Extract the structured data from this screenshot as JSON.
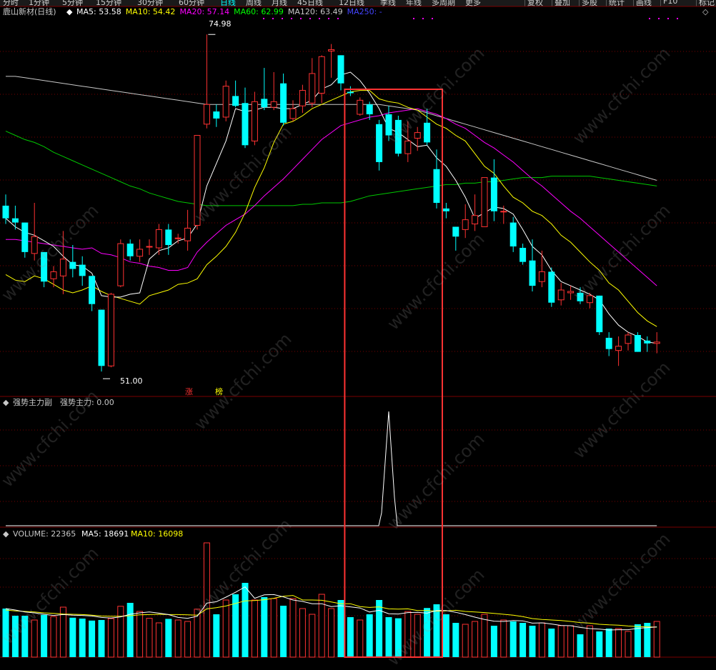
{
  "toolbar": {
    "periods": [
      "分时",
      "1分钟",
      "5分钟",
      "15分钟",
      "30分钟",
      "60分钟",
      "日线",
      "周线",
      "月线",
      "45日线",
      "12日线",
      "季线",
      "年线",
      "多周期",
      "更多"
    ],
    "active_period": "日线",
    "right_buttons": [
      "复权",
      "叠加",
      "多股",
      "统计",
      "画线",
      "F10",
      "标记"
    ]
  },
  "main_panel": {
    "title": "鹿山新材(日线)",
    "ma_labels": [
      {
        "name": "MA5",
        "value": "53.58",
        "color": "#ffffff"
      },
      {
        "name": "MA10",
        "value": "54.42",
        "color": "#ffff00"
      },
      {
        "name": "MA20",
        "value": "57.14",
        "color": "#ff00ff"
      },
      {
        "name": "MA60",
        "value": "62.99",
        "color": "#00ff00"
      },
      {
        "name": "MA120",
        "value": "63.49",
        "color": "#c8c8c8"
      },
      {
        "name": "MA250",
        "value": "-",
        "color": "#4444ff"
      }
    ],
    "high_label": "74.98",
    "low_label": "51.00",
    "tag_zhang": "涨",
    "tag_bang": "榜"
  },
  "indicator_panel": {
    "title": "强势主力副",
    "value_label": "强势主力: 0.00"
  },
  "volume_panel": {
    "title": "VOLUME: 22365",
    "ma5": "MA5: 18691",
    "ma10": "MA10: 16098"
  },
  "watermark": "www.cfchi.com",
  "colors": {
    "up": "#ff3232",
    "down": "#00ffff",
    "highlight_box": "#ff3232",
    "grid": "#7a0000"
  },
  "chart_data": {
    "type": "candlestick",
    "price_range": [
      51.0,
      74.98
    ],
    "candles": [
      {
        "o": 62.8,
        "c": 61.9,
        "h": 63.6,
        "l": 61.5
      },
      {
        "o": 61.9,
        "c": 61.6,
        "h": 62.8,
        "l": 61.1
      },
      {
        "o": 61.6,
        "c": 59.5,
        "h": 61.6,
        "l": 59.1
      },
      {
        "o": 59.4,
        "c": 60.6,
        "h": 63.0,
        "l": 58.9
      },
      {
        "o": 59.5,
        "c": 57.4,
        "h": 59.5,
        "l": 57.0
      },
      {
        "o": 57.6,
        "c": 58.1,
        "h": 58.5,
        "l": 57.0
      },
      {
        "o": 57.8,
        "c": 59.0,
        "h": 61.0,
        "l": 56.5
      },
      {
        "o": 58.8,
        "c": 58.3,
        "h": 60.0,
        "l": 57.7
      },
      {
        "o": 58.6,
        "c": 57.8,
        "h": 59.2,
        "l": 57.1
      },
      {
        "o": 57.8,
        "c": 55.8,
        "h": 57.8,
        "l": 55.3
      },
      {
        "o": 55.4,
        "c": 51.4,
        "h": 55.4,
        "l": 51.0
      },
      {
        "o": 51.4,
        "c": 56.5,
        "h": 56.6,
        "l": 51.3
      },
      {
        "o": 57.1,
        "c": 60.1,
        "h": 60.4,
        "l": 57.0
      },
      {
        "o": 60.1,
        "c": 59.2,
        "h": 60.4,
        "l": 58.9
      },
      {
        "o": 59.2,
        "c": 59.7,
        "h": 60.4,
        "l": 58.8
      },
      {
        "o": 59.9,
        "c": 59.9,
        "h": 60.4,
        "l": 59.3
      },
      {
        "o": 59.8,
        "c": 61.1,
        "h": 61.5,
        "l": 59.3
      },
      {
        "o": 61.1,
        "c": 60.0,
        "h": 61.5,
        "l": 59.3
      },
      {
        "o": 60.5,
        "c": 60.5,
        "h": 60.8,
        "l": 60.1
      },
      {
        "o": 60.3,
        "c": 61.2,
        "h": 62.5,
        "l": 59.6
      },
      {
        "o": 61.4,
        "c": 67.8,
        "h": 67.8,
        "l": 61.1
      },
      {
        "o": 68.6,
        "c": 70.0,
        "h": 74.98,
        "l": 68.3
      },
      {
        "o": 69.5,
        "c": 69.0,
        "h": 70.0,
        "l": 68.4
      },
      {
        "o": 69.1,
        "c": 71.3,
        "h": 71.7,
        "l": 68.8
      },
      {
        "o": 70.6,
        "c": 69.9,
        "h": 71.7,
        "l": 69.8
      },
      {
        "o": 70.1,
        "c": 67.1,
        "h": 71.2,
        "l": 66.9
      },
      {
        "o": 67.4,
        "c": 70.2,
        "h": 70.9,
        "l": 67.1
      },
      {
        "o": 70.4,
        "c": 69.8,
        "h": 72.6,
        "l": 69.6
      },
      {
        "o": 69.8,
        "c": 70.2,
        "h": 72.3,
        "l": 69.6
      },
      {
        "o": 71.5,
        "c": 68.7,
        "h": 72.2,
        "l": 68.5
      },
      {
        "o": 69.0,
        "c": 69.7,
        "h": 70.3,
        "l": 68.8
      },
      {
        "o": 69.9,
        "c": 71.0,
        "h": 71.4,
        "l": 69.4
      },
      {
        "o": 70.1,
        "c": 72.2,
        "h": 73.3,
        "l": 69.8
      },
      {
        "o": 70.8,
        "c": 73.4,
        "h": 73.5,
        "l": 70.1
      },
      {
        "o": 73.8,
        "c": 73.9,
        "h": 74.3,
        "l": 71.9
      },
      {
        "o": 73.5,
        "c": 71.5,
        "h": 73.5,
        "l": 71.0
      },
      {
        "o": 70.9,
        "c": 70.8,
        "h": 71.3,
        "l": 70.6
      },
      {
        "o": 69.3,
        "c": 70.3,
        "h": 70.5,
        "l": 69.2
      },
      {
        "o": 70.0,
        "c": 69.3,
        "h": 70.2,
        "l": 68.9
      },
      {
        "o": 68.6,
        "c": 65.9,
        "h": 68.9,
        "l": 65.3
      },
      {
        "o": 69.3,
        "c": 67.8,
        "h": 69.9,
        "l": 67.4
      },
      {
        "o": 68.9,
        "c": 66.5,
        "h": 69.2,
        "l": 66.3
      },
      {
        "o": 66.5,
        "c": 67.4,
        "h": 68.8,
        "l": 65.9
      },
      {
        "o": 67.6,
        "c": 68.0,
        "h": 68.4,
        "l": 66.7
      },
      {
        "o": 68.7,
        "c": 67.3,
        "h": 69.7,
        "l": 67.1
      },
      {
        "o": 65.4,
        "c": 63.0,
        "h": 66.8,
        "l": 62.6
      },
      {
        "o": 62.6,
        "c": 62.4,
        "h": 63.0,
        "l": 61.9
      },
      {
        "o": 61.3,
        "c": 60.6,
        "h": 61.3,
        "l": 59.6
      },
      {
        "o": 61.1,
        "c": 61.8,
        "h": 62.9,
        "l": 60.5
      },
      {
        "o": 61.5,
        "c": 62.1,
        "h": 63.6,
        "l": 61.0
      },
      {
        "o": 61.3,
        "c": 64.8,
        "h": 64.8,
        "l": 61.3
      },
      {
        "o": 64.8,
        "c": 62.4,
        "h": 66.1,
        "l": 61.7
      },
      {
        "o": 62.4,
        "c": 62.4,
        "h": 62.8,
        "l": 61.5
      },
      {
        "o": 61.6,
        "c": 59.9,
        "h": 62.0,
        "l": 59.5
      },
      {
        "o": 59.8,
        "c": 58.8,
        "h": 60.1,
        "l": 58.6
      },
      {
        "o": 58.9,
        "c": 57.1,
        "h": 60.4,
        "l": 56.7
      },
      {
        "o": 57.4,
        "c": 58.1,
        "h": 59.6,
        "l": 57.0
      },
      {
        "o": 58.1,
        "c": 55.9,
        "h": 58.4,
        "l": 55.6
      },
      {
        "o": 56.1,
        "c": 56.8,
        "h": 57.3,
        "l": 55.7
      },
      {
        "o": 56.6,
        "c": 56.7,
        "h": 57.1,
        "l": 56.1
      },
      {
        "o": 56.6,
        "c": 56.0,
        "h": 57.0,
        "l": 55.8
      },
      {
        "o": 55.9,
        "c": 56.4,
        "h": 56.6,
        "l": 55.5
      },
      {
        "o": 56.4,
        "c": 53.8,
        "h": 56.4,
        "l": 53.6
      },
      {
        "o": 53.4,
        "c": 52.6,
        "h": 53.8,
        "l": 52.1
      },
      {
        "o": 52.5,
        "c": 52.8,
        "h": 53.5,
        "l": 51.4
      },
      {
        "o": 53.0,
        "c": 53.6,
        "h": 53.8,
        "l": 52.5
      },
      {
        "o": 53.6,
        "c": 52.4,
        "h": 53.8,
        "l": 52.4
      },
      {
        "o": 53.2,
        "c": 53.0,
        "h": 53.5,
        "l": 52.4
      },
      {
        "o": 53.0,
        "c": 53.1,
        "h": 53.8,
        "l": 52.3
      }
    ],
    "ma5": [
      61.9,
      61.3,
      60.9,
      60.7,
      60.3,
      59.9,
      59.2,
      58.6,
      58.5,
      58.0,
      56.4,
      56.3,
      56.3,
      56.5,
      56.6,
      59.0,
      59.6,
      59.8,
      60.3,
      60.5,
      61.5,
      64.2,
      65.8,
      67.4,
      69.7,
      69.5,
      69.6,
      69.8,
      69.8,
      69.7,
      69.7,
      70.0,
      70.3,
      71.1,
      71.4,
      72.1,
      72.3,
      71.7,
      70.8,
      69.7,
      68.3,
      68.0,
      67.5,
      67.0,
      67.1,
      66.2,
      65.6,
      64.6,
      63.4,
      61.9,
      62.3,
      62.7,
      62.6,
      62.2,
      61.1,
      59.9,
      59.3,
      58.2,
      57.4,
      57.1,
      56.8,
      56.5,
      56.1,
      55.1,
      54.3,
      53.8,
      53.5,
      53.1,
      53.0
    ],
    "ma10": [
      57.9,
      57.5,
      57.4,
      57.8,
      57.6,
      57.2,
      56.8,
      56.6,
      56.8,
      57.1,
      56.7,
      56.4,
      56.2,
      56.0,
      55.8,
      56.4,
      56.6,
      56.8,
      57.2,
      57.3,
      57.6,
      58.6,
      59.2,
      59.9,
      60.9,
      62.3,
      64.1,
      65.5,
      67.3,
      68.6,
      68.8,
      69.2,
      69.7,
      70.0,
      70.3,
      70.6,
      70.9,
      71.0,
      71.0,
      70.4,
      70.2,
      70.1,
      69.8,
      69.6,
      69.1,
      68.6,
      68.3,
      67.8,
      67.4,
      66.5,
      65.6,
      65.1,
      64.2,
      63.4,
      63.0,
      62.4,
      62.1,
      61.5,
      60.7,
      60.2,
      59.5,
      58.8,
      58.2,
      57.3,
      56.8,
      56.0,
      55.2,
      54.6,
      54.2
    ],
    "ma20": [
      60.4,
      60.4,
      60.3,
      60.2,
      60.1,
      60.0,
      59.9,
      59.8,
      59.7,
      59.8,
      59.4,
      59.3,
      59.1,
      58.8,
      58.7,
      58.5,
      58.4,
      58.2,
      58.2,
      58.4,
      59.5,
      60.2,
      60.8,
      61.4,
      61.8,
      62.2,
      62.8,
      63.5,
      64.1,
      64.7,
      65.4,
      66.1,
      66.8,
      67.5,
      68.0,
      68.5,
      68.7,
      68.9,
      69.1,
      69.2,
      69.4,
      69.5,
      69.6,
      69.7,
      69.5,
      69.3,
      69.0,
      68.6,
      68.3,
      67.8,
      67.3,
      66.9,
      66.4,
      65.9,
      65.3,
      64.7,
      64.2,
      63.6,
      63.0,
      62.4,
      61.9,
      61.3,
      60.7,
      60.1,
      59.5,
      58.9,
      58.3,
      57.7,
      57.1
    ],
    "ma60": [
      68.1,
      67.8,
      67.5,
      67.3,
      67.0,
      66.6,
      66.3,
      66.0,
      65.7,
      65.4,
      65.1,
      64.8,
      64.5,
      64.2,
      64.0,
      63.7,
      63.5,
      63.3,
      63.1,
      63.0,
      62.9,
      62.8,
      62.8,
      62.8,
      62.8,
      62.8,
      62.8,
      62.8,
      62.8,
      62.8,
      62.8,
      62.9,
      62.9,
      63.0,
      63.0,
      63.0,
      63.1,
      63.3,
      63.5,
      63.6,
      63.7,
      63.8,
      63.9,
      64.0,
      64.1,
      64.2,
      64.3,
      64.3,
      64.4,
      64.4,
      64.5,
      64.5,
      64.6,
      64.7,
      64.8,
      64.8,
      64.8,
      64.9,
      64.9,
      64.9,
      64.9,
      64.9,
      64.8,
      64.7,
      64.6,
      64.5,
      64.4,
      64.3,
      64.2
    ],
    "ma120": [
      72.0,
      72.0,
      71.9,
      71.8,
      71.7,
      71.6,
      71.5,
      71.4,
      71.3,
      71.2,
      71.1,
      71.0,
      70.9,
      70.8,
      70.7,
      70.6,
      70.5,
      70.4,
      70.3,
      70.2,
      70.1,
      70.0,
      70.0,
      70.0,
      70.0,
      70.0,
      70.0,
      70.0,
      70.0,
      70.0,
      70.0,
      70.0,
      70.0,
      70.0,
      70.0,
      70.0,
      70.0,
      70.0,
      70.0,
      70.0,
      69.9,
      69.8,
      69.7,
      69.6,
      69.4,
      69.2,
      69.0,
      68.8,
      68.6,
      68.4,
      68.2,
      68.0,
      67.8,
      67.6,
      67.4,
      67.2,
      67.0,
      66.8,
      66.6,
      66.4,
      66.2,
      66.0,
      65.8,
      65.6,
      65.4,
      65.2,
      65.0,
      64.8,
      64.6
    ],
    "indicator": {
      "spike_index": 40,
      "spike_value": 1.0,
      "baseline": 0.0
    },
    "volume": [
      17000,
      14500,
      14500,
      13000,
      14800,
      14200,
      17500,
      13800,
      13500,
      12800,
      13000,
      13500,
      17800,
      19000,
      16000,
      13600,
      12000,
      13400,
      13000,
      12500,
      16800,
      40000,
      15000,
      20000,
      22000,
      26000,
      20000,
      21000,
      20500,
      18000,
      20500,
      17000,
      15000,
      22000,
      17000,
      20000,
      14000,
      13000,
      15000,
      20000,
      14000,
      13600,
      16000,
      15000,
      17200,
      18500,
      15000,
      12000,
      11500,
      12500,
      15000,
      11000,
      13000,
      12500,
      12000,
      11000,
      12000,
      10000,
      11000,
      11000,
      8000,
      11000,
      9000,
      10000,
      10000,
      9000,
      11500,
      12000,
      12500
    ],
    "vol_ma5": [
      17000,
      16500,
      15800,
      15500,
      15000,
      14600,
      14900,
      14700,
      14600,
      14400,
      13900,
      13700,
      14100,
      15000,
      15500,
      15800,
      15400,
      14900,
      13900,
      13600,
      14300,
      18900,
      19400,
      21000,
      22700,
      24600,
      20600,
      21800,
      21900,
      21100,
      20000,
      19500,
      18700,
      18700,
      17700,
      18000,
      17600,
      17200,
      15800,
      16400,
      15200,
      15100,
      15600,
      15700,
      15400,
      16300,
      16300,
      15700,
      14900,
      14000,
      13200,
      12600,
      12500,
      12800,
      12700,
      11900,
      12000,
      11600,
      11100,
      11000,
      10400,
      10000,
      9800,
      9500,
      9600,
      9600,
      10100,
      10300,
      10600
    ],
    "vol_ma10": [
      16500,
      16200,
      16000,
      15800,
      15500,
      15300,
      15100,
      15000,
      14900,
      14700,
      14400,
      14300,
      14300,
      14500,
      14800,
      14900,
      15000,
      14900,
      14900,
      14800,
      14700,
      16900,
      17300,
      17900,
      18800,
      19700,
      19800,
      20100,
      20600,
      21300,
      21600,
      20000,
      20000,
      19900,
      19300,
      18700,
      18700,
      17700,
      17400,
      17600,
      16900,
      16800,
      16900,
      16300,
      16300,
      16100,
      16200,
      16400,
      16000,
      15800,
      15600,
      15300,
      15000,
      14700,
      14200,
      13500,
      13200,
      13000,
      12800,
      12500,
      12100,
      11900,
      11500,
      11300,
      11200,
      10900,
      10700,
      10600,
      10500
    ],
    "highlight_range": {
      "start_index": 36,
      "end_index": 45
    }
  }
}
